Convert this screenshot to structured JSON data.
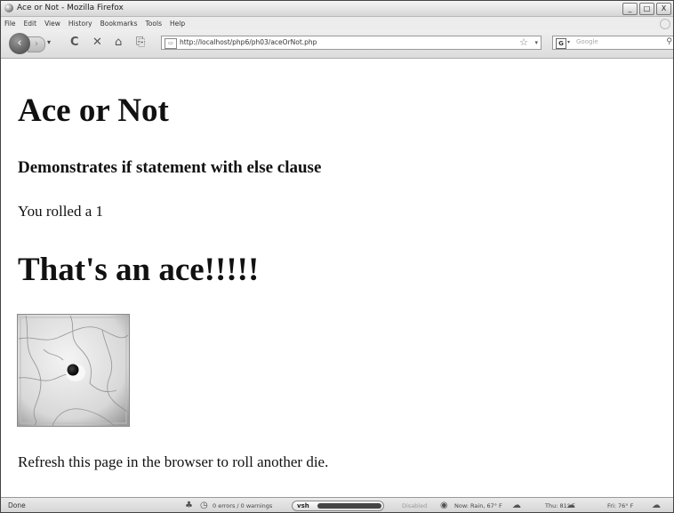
{
  "window": {
    "title": "Ace or Not - Mozilla Firefox",
    "buttons": {
      "minimize": "_",
      "maximize": "□",
      "close": "X"
    }
  },
  "menu": [
    "File",
    "Edit",
    "View",
    "History",
    "Bookmarks",
    "Tools",
    "Help"
  ],
  "nav": {
    "back_glyph": "‹",
    "forward_glyph": "›",
    "dropdown_glyph": "▾",
    "reload_glyph": "C",
    "stop_glyph": "✕",
    "home_glyph": "⌂",
    "url": "http://localhost/php6/ph03/aceOrNot.php",
    "search_placeholder": "Google",
    "search_engine_glyph": "G"
  },
  "page": {
    "heading": "Ace or Not",
    "subheading": "Demonstrates if statement with else clause",
    "roll_text": "You rolled a 1",
    "result": "That's an ace!!!!!",
    "footer_text": "Refresh this page in the browser to roll another die.",
    "die_value": 1
  },
  "status": {
    "done": "Done",
    "errors": "0 errors / 0 warnings",
    "vsh_label": "vsh",
    "disabled": "Disabled",
    "weather_now": "Now: Rain, 67° F",
    "weather_thu": "Thu: 81° F",
    "weather_fri": "Fri: 76° F"
  }
}
